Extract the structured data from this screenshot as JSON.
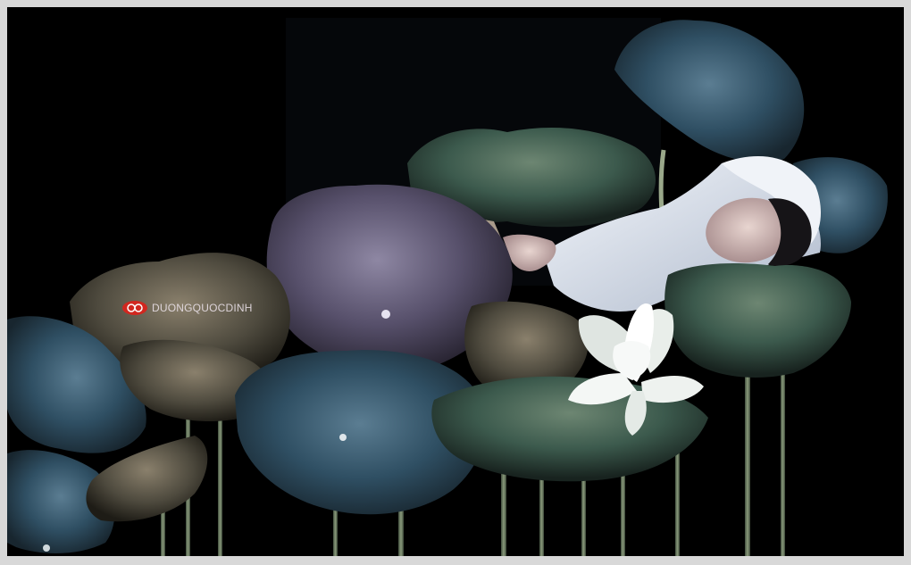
{
  "photo": {
    "watermark_text": "DUONGQUOCDINH",
    "colors": {
      "background": "#000000",
      "frame": "#d8d8d8",
      "leaf_blue": "#2f4f63",
      "leaf_green": "#3c5a4d",
      "leaf_purple": "#57506b",
      "dress_white": "#dfe6f0",
      "lotus_white": "#f1f4f2",
      "watermark_red": "#d1271f"
    },
    "icons": [
      "camera-logo-icon"
    ]
  }
}
